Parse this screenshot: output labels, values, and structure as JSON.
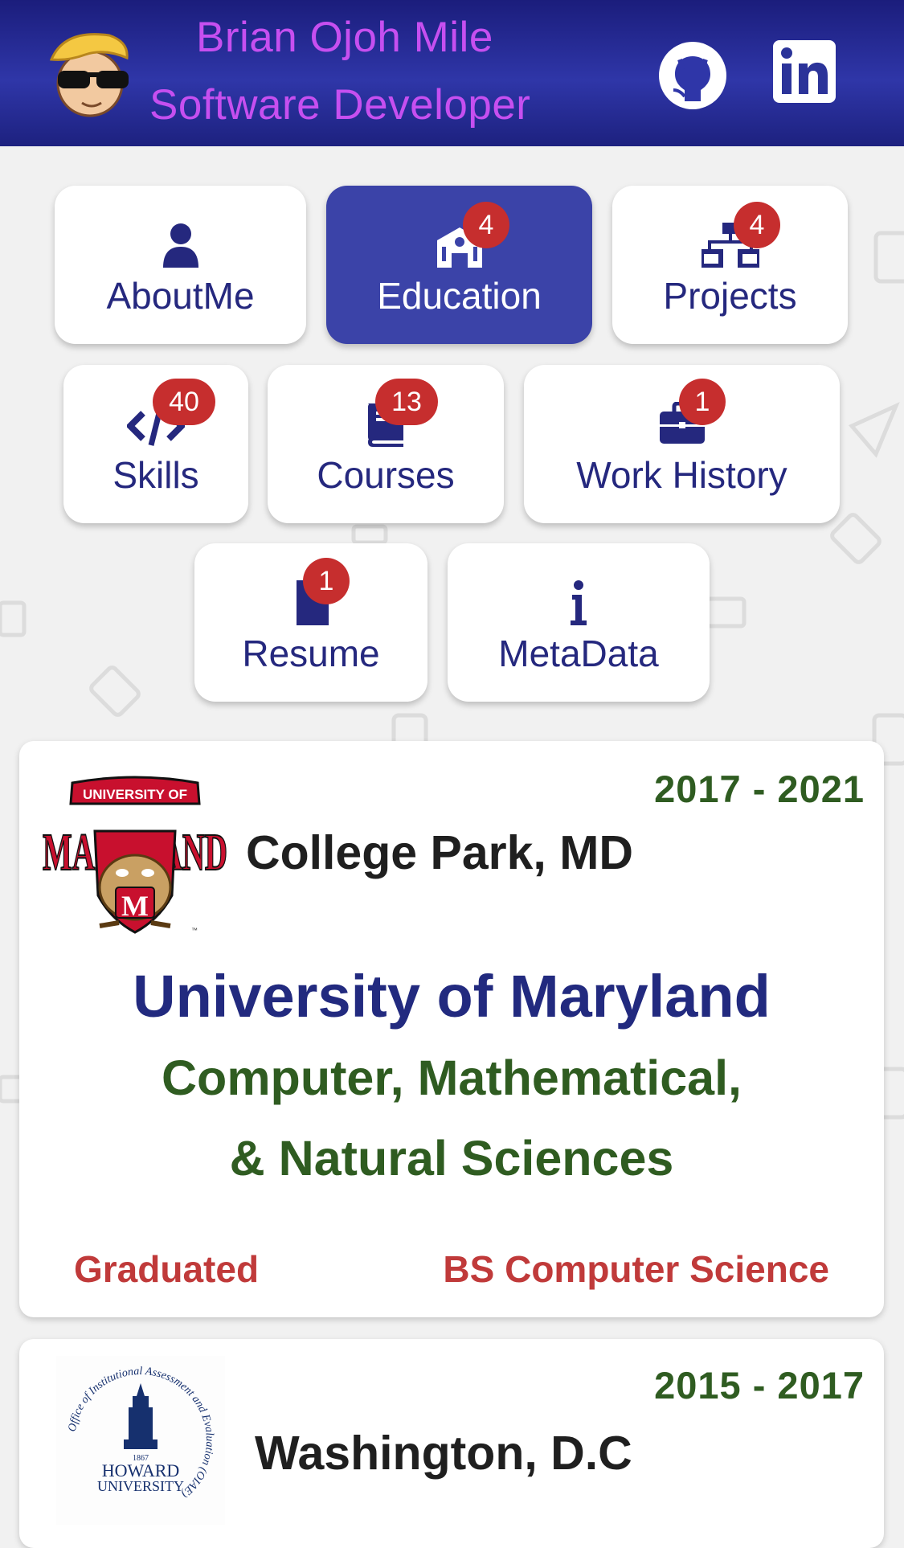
{
  "header": {
    "name": "Brian Ojoh Mile",
    "role": "Software Developer",
    "colors": {
      "bar": "#2f36a8",
      "title": "#c64ff0"
    }
  },
  "nav": [
    {
      "label": "AboutMe",
      "icon": "user-icon",
      "badge": "",
      "active": false
    },
    {
      "label": "Education",
      "icon": "school-icon",
      "badge": "4",
      "active": true
    },
    {
      "label": "Projects",
      "icon": "sitemap-icon",
      "badge": "4",
      "active": false
    },
    {
      "label": "Skills",
      "icon": "code-icon",
      "badge": "40",
      "active": false
    },
    {
      "label": "Courses",
      "icon": "book-icon",
      "badge": "13",
      "active": false
    },
    {
      "label": "Work History",
      "icon": "briefcase-icon",
      "badge": "1",
      "active": false
    },
    {
      "label": "Resume",
      "icon": "file-icon",
      "badge": "1",
      "active": false
    },
    {
      "label": "MetaData",
      "icon": "info-icon",
      "badge": "",
      "active": false
    }
  ],
  "education": [
    {
      "dates": "2017 - 2021",
      "city": "College Park, MD",
      "school": "University of Maryland",
      "college": "Computer, Mathematical, & Natural Sciences",
      "status": "Graduated",
      "degree": "BS Computer Science",
      "logo": {
        "top_text": "UNIVERSITY OF",
        "main_text": "MARYLAND",
        "shield_text": "M",
        "tm": "™"
      }
    },
    {
      "dates": "2015 - 2017",
      "city": "Washington, D.C",
      "logo": {
        "ring_text": "Office of Institutional Assessment and Evaluation (OIAE)",
        "year": "1867",
        "line1": "HOWARD",
        "line2": "UNIVERSITY"
      }
    }
  ]
}
